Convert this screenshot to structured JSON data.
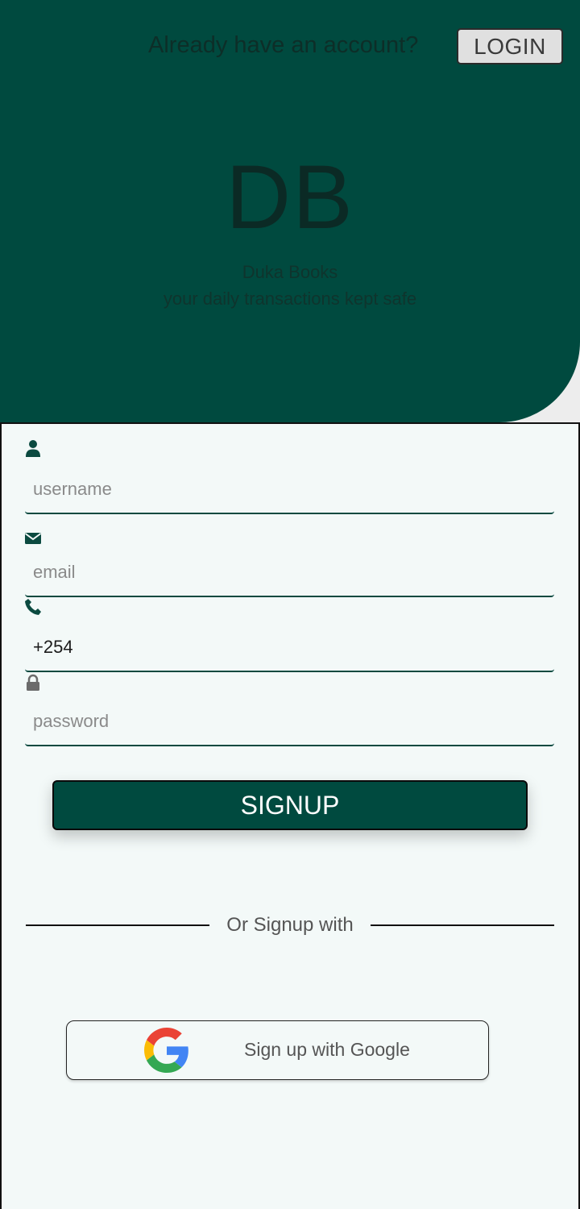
{
  "colors": {
    "primary": "#004a3f",
    "form_background": "#f3f9f8",
    "page_background": "#ededed"
  },
  "header": {
    "prompt_text": "Already have an account?",
    "login_label": "LOGIN"
  },
  "branding": {
    "logo_text": "DB",
    "name": "Duka Books",
    "tagline": "your daily transactions kept safe"
  },
  "form": {
    "fields": [
      {
        "icon": "user-icon",
        "placeholder": "username",
        "value": ""
      },
      {
        "icon": "envelope-icon",
        "placeholder": "email",
        "value": ""
      },
      {
        "icon": "phone-icon",
        "placeholder": "",
        "value": "+254"
      },
      {
        "icon": "lock-icon",
        "placeholder": "password",
        "value": ""
      }
    ],
    "signup_label": "SIGNUP"
  },
  "social": {
    "divider_text": "Or Signup with",
    "google_label": "Sign up with Google",
    "google_icon": "google-icon"
  }
}
